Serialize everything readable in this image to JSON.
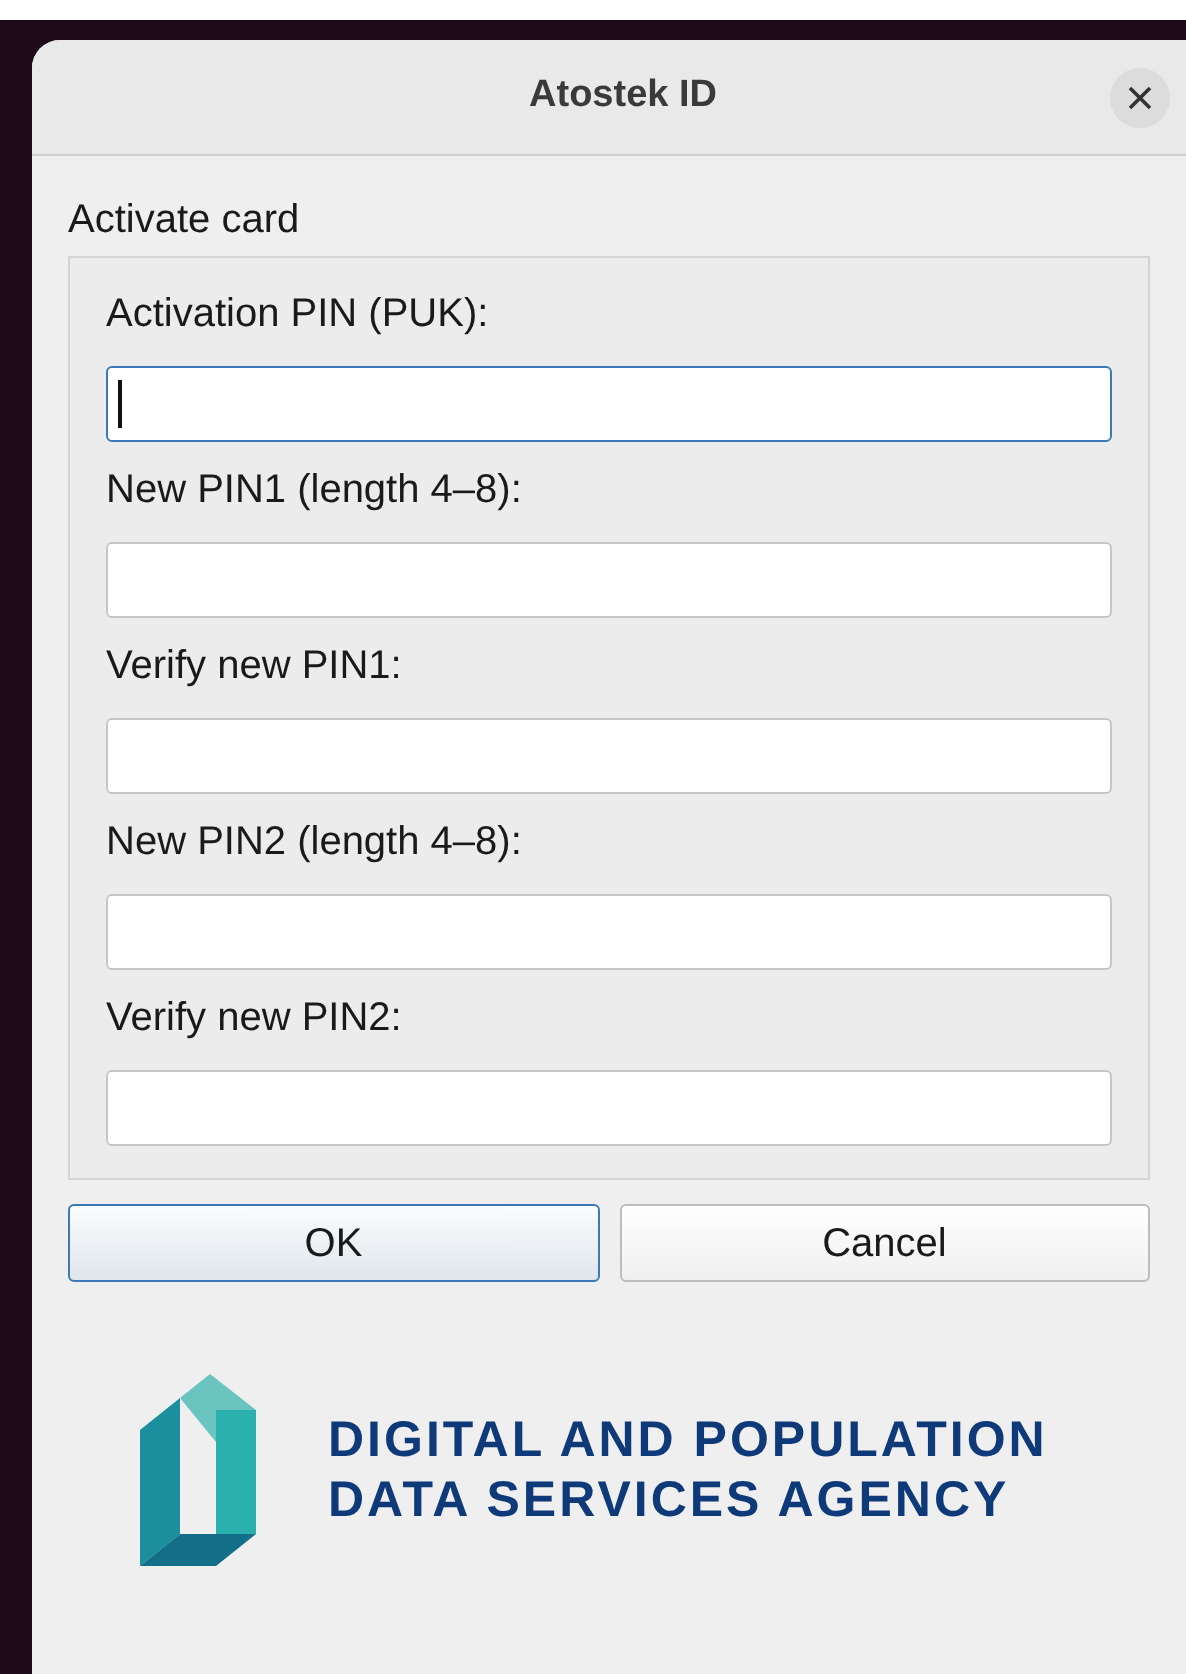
{
  "window": {
    "title": "Atostek ID"
  },
  "group": {
    "title": "Activate card"
  },
  "fields": [
    {
      "label": "Activation PIN (PUK):",
      "focused": true
    },
    {
      "label": "New PIN1 (length 4–8):",
      "focused": false
    },
    {
      "label": "Verify new PIN1:",
      "focused": false
    },
    {
      "label": "New PIN2 (length 4–8):",
      "focused": false
    },
    {
      "label": "Verify new PIN2:",
      "focused": false
    }
  ],
  "buttons": [
    {
      "label": "OK",
      "default": true
    },
    {
      "label": "Cancel",
      "default": false
    }
  ],
  "agency": {
    "lines": [
      "DIGITAL AND POPULATION",
      "DATA SERVICES AGENCY"
    ]
  }
}
